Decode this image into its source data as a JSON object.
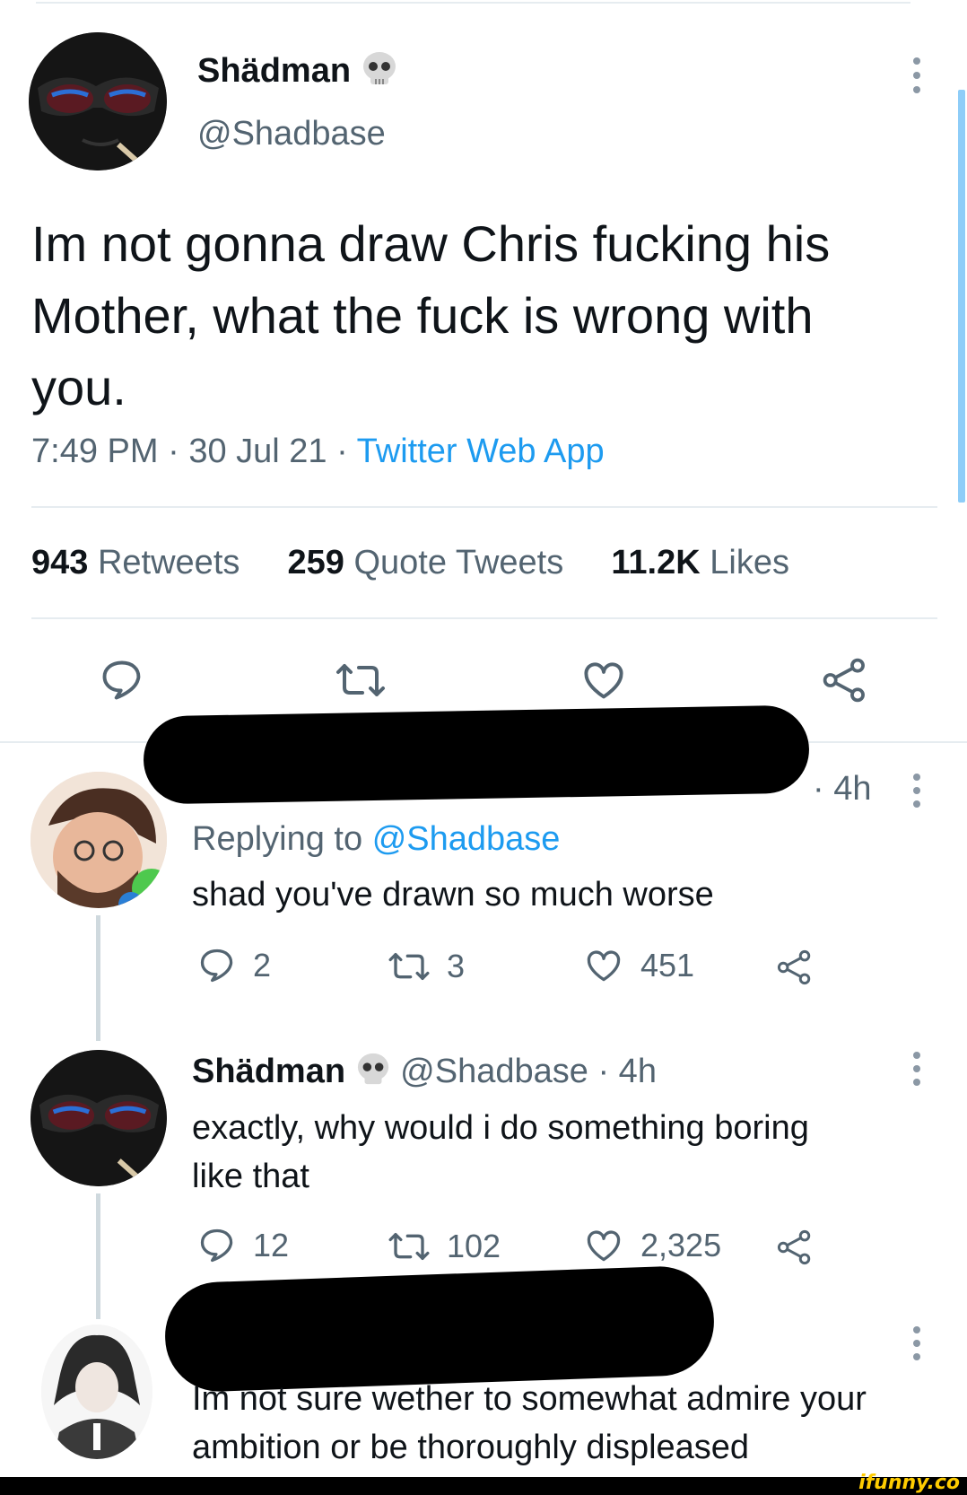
{
  "main_tweet": {
    "display_name": "Shädman",
    "handle": "@Shadbase",
    "text_lines": [
      "Im not gonna draw Chris fucking his",
      "Mother, what the fuck is wrong with",
      "you."
    ],
    "time": "7:49 PM",
    "date": "30 Jul 21",
    "source": "Twitter Web App",
    "stats": {
      "retweets_count": "943",
      "retweets_label": "Retweets",
      "quotes_count": "259",
      "quotes_label": "Quote Tweets",
      "likes_count": "11.2K",
      "likes_label": "Likes"
    }
  },
  "replies": [
    {
      "time": "· 4h",
      "replying_prefix": "Replying to",
      "replying_handle": "@Shadbase",
      "text": "shad you've drawn so much worse",
      "reply_count": "2",
      "retweet_count": "3",
      "like_count": "451"
    },
    {
      "display_name": "Shädman",
      "handle": "@Shadbase",
      "time": "· 4h",
      "text_lines": [
        "exactly, why would i do something boring",
        "like that"
      ],
      "reply_count": "12",
      "retweet_count": "102",
      "like_count": "2,325"
    },
    {
      "text_lines": [
        "Im not sure wether to somewhat admire your",
        "ambition or be thoroughly displeased"
      ]
    }
  ],
  "watermark": "ifunny.co",
  "colors": {
    "link": "#1d9bf0",
    "muted": "#536471",
    "divider": "#e6ecf0",
    "scroll_indicator": "#8ecdf8"
  }
}
